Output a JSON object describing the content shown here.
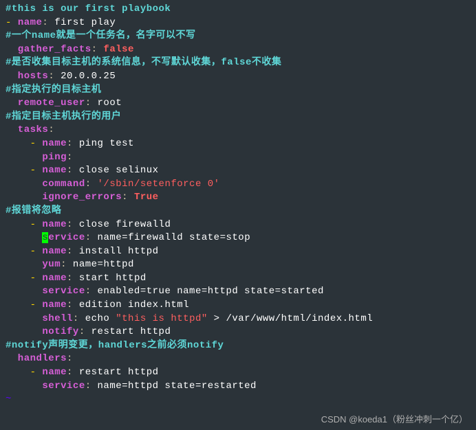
{
  "lines": {
    "l1_comment": "#this is our first playbook",
    "l2_dash": "- ",
    "l2_key": "name",
    "l2_val": " first play",
    "l3_comment": "#一个name就是一个任务名，名字可以不写",
    "l4_key": "  gather_facts",
    "l4_val": " false",
    "l5_comment": "#是否收集目标主机的系统信息，不写默认收集，false不收集",
    "l6_key": "  hosts",
    "l6_val": " 20.0.0.25",
    "l7_comment": "#指定执行的目标主机",
    "l8_key": "  remote_user",
    "l8_val": " root",
    "l9_comment": "#指定目标主机执行的用户",
    "l10_key": "  tasks",
    "l11_dash": "    - ",
    "l11_key": "name",
    "l11_val": " ping test",
    "l12_key": "      ping",
    "l13_dash": "    - ",
    "l13_key": "name",
    "l13_val": " close selinux",
    "l14_key": "      command",
    "l14_val1": " ",
    "l14_val2": "'/sbin/setenforce 0'",
    "l15_key": "      ignore_errors",
    "l15_val": " True",
    "l16_comment": "#报错将忽略",
    "l17_dash": "    - ",
    "l17_key": "name",
    "l17_val": " close firewalld",
    "l18_pre": "      ",
    "l18_cursor": "s",
    "l18_key": "ervice",
    "l18_val": " name=firewalld state=stop",
    "l19_dash": "    - ",
    "l19_key": "name",
    "l19_val": " install httpd",
    "l20_key": "      yum",
    "l20_val": " name=httpd",
    "l21_dash": "    - ",
    "l21_key": "name",
    "l21_val": " start httpd",
    "l22_key": "      service",
    "l22_val": " enabled=true name=httpd state=started",
    "l23_dash": "    - ",
    "l23_key": "name",
    "l23_val": " edition index.html",
    "l24_key": "      shell",
    "l24_val1": " echo ",
    "l24_str": "\"this is httpd\"",
    "l24_gt": " > ",
    "l24_val2": "/var/www/html/index.html",
    "l25_key": "      notify",
    "l25_val": " restart httpd",
    "l26_comment": "#notify声明变更，handlers之前必须notify",
    "l27_key": "  handlers",
    "l28_dash": "    - ",
    "l28_key": "name",
    "l28_val": " restart httpd",
    "l29_key": "      service",
    "l29_val": " name=httpd state=restarted",
    "l30_tilde": "~"
  },
  "watermark": "CSDN @koeda1（粉丝冲刺一个亿）"
}
